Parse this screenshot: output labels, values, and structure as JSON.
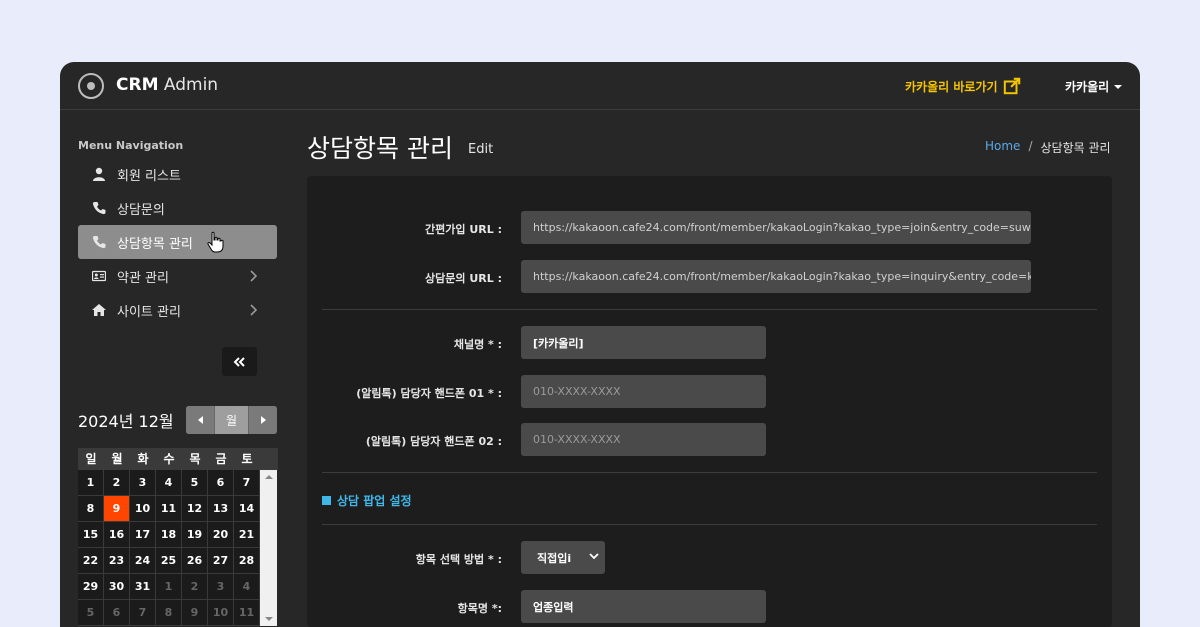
{
  "header": {
    "brand_bold": "CRM",
    "brand_rest": "Admin",
    "kakao_link": "카카올리 바로가기",
    "user": "카카올리"
  },
  "sidebar": {
    "title": "Menu Navigation",
    "items": [
      {
        "label": "회원 리스트",
        "icon": "user-icon"
      },
      {
        "label": "상담문의",
        "icon": "phone-icon"
      },
      {
        "label": "상담항목 관리",
        "icon": "phone-icon"
      },
      {
        "label": "약관 관리",
        "icon": "id-card-icon"
      },
      {
        "label": "사이트 관리",
        "icon": "home-icon"
      }
    ],
    "collapse": "«"
  },
  "calendar": {
    "title": "2024년 12월",
    "month_btn": "월",
    "weekdays": [
      "일",
      "월",
      "화",
      "수",
      "목",
      "금",
      "토"
    ],
    "days": [
      [
        "1",
        "2",
        "3",
        "4",
        "5",
        "6",
        "7"
      ],
      [
        "8",
        "9",
        "10",
        "11",
        "12",
        "13",
        "14"
      ],
      [
        "15",
        "16",
        "17",
        "18",
        "19",
        "20",
        "21"
      ],
      [
        "22",
        "23",
        "24",
        "25",
        "26",
        "27",
        "28"
      ],
      [
        "29",
        "30",
        "31",
        "1",
        "2",
        "3",
        "4"
      ],
      [
        "5",
        "6",
        "7",
        "8",
        "9",
        "10",
        "11"
      ]
    ],
    "today": "9",
    "today_color": "#ff4500"
  },
  "page": {
    "title": "상담항목 관리",
    "subtitle": "Edit",
    "breadcrumb_home": "Home",
    "breadcrumb_sep": "/",
    "breadcrumb_current": "상담항목 관리"
  },
  "form": {
    "join_url_label": "간편가입 URL :",
    "join_url_value": "https://kakaoon.cafe24.com/front/member/kakaoLogin?kakao_type=join&entry_code=suwo",
    "inquiry_url_label": "상담문의 URL :",
    "inquiry_url_value": "https://kakaoon.cafe24.com/front/member/kakaoLogin?kakao_type=inquiry&entry_code=ka",
    "channel_label": "채널명 * :",
    "channel_value": "[카카올리]",
    "phone1_label": "(알림톡) 담당자 핸드폰 01 * :",
    "phone1_placeholder": "010-XXXX-XXXX",
    "phone2_label": "(알림톡) 담당자 핸드폰 02 :",
    "phone2_placeholder": "010-XXXX-XXXX",
    "section_title": "상담 팝업 설정",
    "method_label": "항목 선택 방법 * :",
    "method_value": "직접입i",
    "item_name_label": "항목명 *:",
    "item_name_value": "업종입력"
  },
  "colors": {
    "accent_yellow": "#f5c400",
    "accent_blue": "#3fb7e8",
    "link_blue": "#5aa9e6"
  }
}
